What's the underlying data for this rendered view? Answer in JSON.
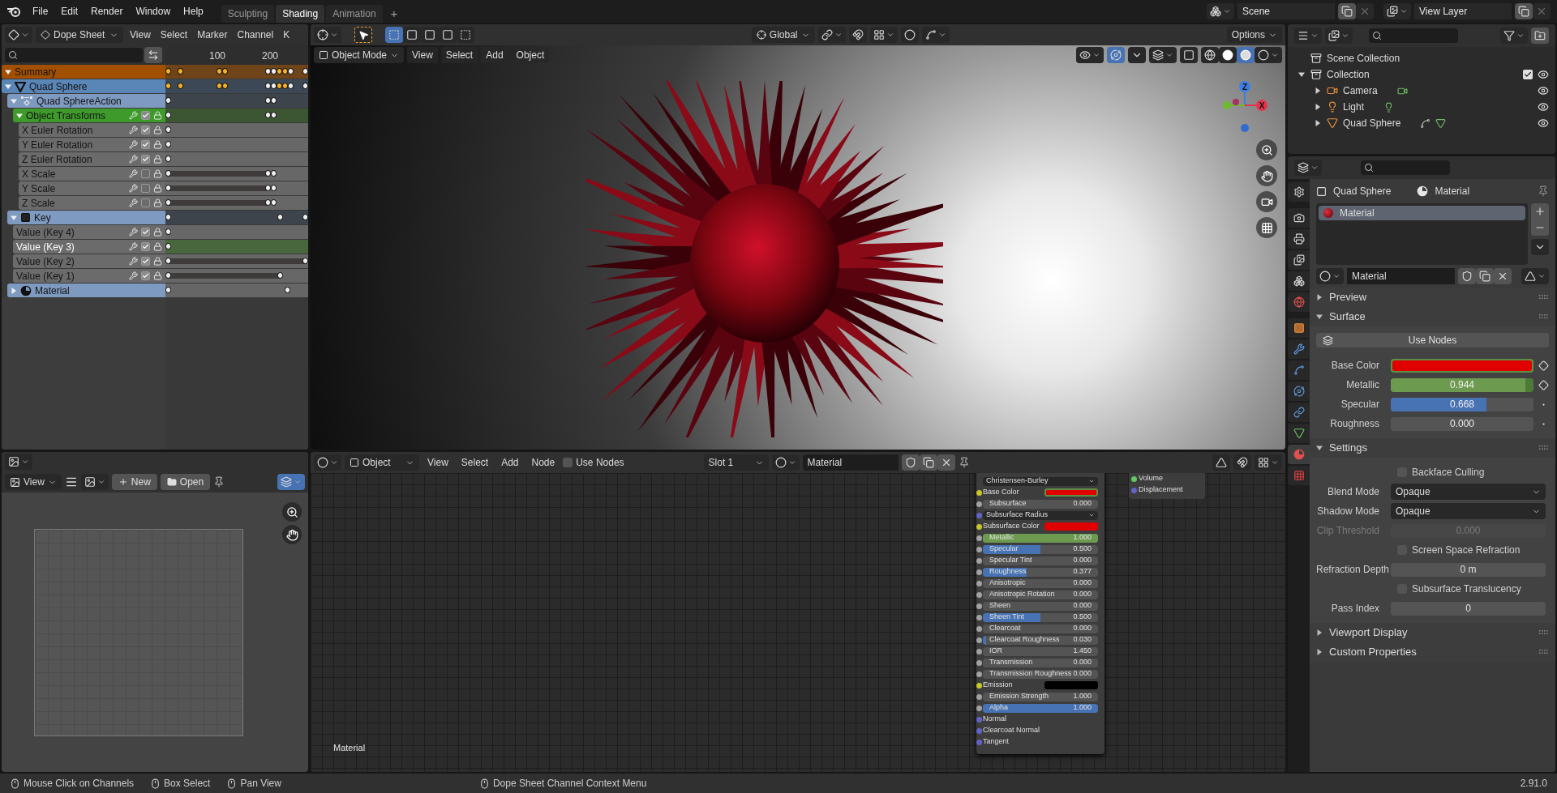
{
  "menu": [
    "File",
    "Edit",
    "Render",
    "Window",
    "Help"
  ],
  "workspaces": [
    {
      "label": "Sculpting",
      "selected": false
    },
    {
      "label": "Shading",
      "selected": true
    },
    {
      "label": "Animation",
      "selected": false
    }
  ],
  "add_workspace": "+",
  "scene": "Scene",
  "view_layer": "View Layer",
  "dope_sheet": {
    "mode": "Dope Sheet",
    "menus": [
      "View",
      "Select",
      "Marker",
      "Channel",
      "K"
    ],
    "ruler": [
      "100",
      "200"
    ],
    "channels": [
      {
        "name": "Summary",
        "kind": "summary",
        "expanded": true,
        "selected": false,
        "children": [
          {
            "name": "Quad Sphere",
            "kind": "object",
            "expanded": true,
            "selected": false,
            "children": [
              {
                "name": "Quad SphereAction",
                "kind": "action",
                "expanded": true,
                "selected": false,
                "children": [
                  {
                    "name": "Object Transforms",
                    "kind": "group",
                    "expanded": true,
                    "checked": true,
                    "selected": false,
                    "children": [
                      {
                        "name": "X Euler Rotation",
                        "kind": "fcurve",
                        "checked": true,
                        "selected": false
                      },
                      {
                        "name": "Y Euler Rotation",
                        "kind": "fcurve",
                        "checked": true,
                        "selected": false
                      },
                      {
                        "name": "Z Euler Rotation",
                        "kind": "fcurve",
                        "checked": true,
                        "selected": false
                      },
                      {
                        "name": "X Scale",
                        "kind": "fcurve",
                        "checked": false,
                        "selected": false
                      },
                      {
                        "name": "Y Scale",
                        "kind": "fcurve",
                        "checked": false,
                        "selected": false
                      },
                      {
                        "name": "Z Scale",
                        "kind": "fcurve",
                        "checked": false,
                        "selected": false
                      }
                    ]
                  }
                ]
              },
              {
                "name": "Key",
                "kind": "shapekey",
                "expanded": true,
                "selected": false,
                "children": [
                  {
                    "name": "Value (Key 4)",
                    "kind": "fcurve",
                    "checked": true,
                    "selected": false
                  },
                  {
                    "name": "Value (Key 3)",
                    "kind": "fcurve",
                    "checked": true,
                    "selected": true
                  },
                  {
                    "name": "Value (Key 2)",
                    "kind": "fcurve",
                    "checked": true,
                    "selected": false
                  },
                  {
                    "name": "Value (Key 1)",
                    "kind": "fcurve",
                    "checked": true,
                    "selected": false
                  }
                ]
              },
              {
                "name": "Material",
                "kind": "material",
                "expanded": false,
                "selected": false
              }
            ]
          }
        ]
      }
    ]
  },
  "image_editor": {
    "view": "View",
    "new": "New",
    "open": "Open"
  },
  "viewport": {
    "orientation": "Global",
    "options": "Options",
    "mode": "Object Mode",
    "menus": [
      "View",
      "Select",
      "Add",
      "Object"
    ],
    "gizmo_labels": [
      {
        "label": "Z",
        "color": "#3d7ee6"
      },
      {
        "label": "X",
        "color": "#e6334d"
      }
    ]
  },
  "node_editor": {
    "type": "Object",
    "menus": [
      "View",
      "Select",
      "Add",
      "Node"
    ],
    "use_nodes": {
      "label": "Use Nodes",
      "checked": false
    },
    "slot": "Slot 1",
    "material": "Material",
    "label": "Material",
    "bsdf": {
      "method": "Christensen-Burley",
      "inputs": [
        {
          "label": "Base Color",
          "kind": "color",
          "color": "#e00000",
          "animated": true
        },
        {
          "label": "Subsurface",
          "kind": "value",
          "value": "0.000",
          "level": 0,
          "animated": false
        },
        {
          "label": "Subsurface Radius",
          "kind": "menu"
        },
        {
          "label": "Subsurface Color",
          "kind": "color",
          "color": "#e00000",
          "animated": false
        },
        {
          "label": "Metallic",
          "kind": "value",
          "value": "1.000",
          "level": 1,
          "animated": true
        },
        {
          "label": "Specular",
          "kind": "value",
          "value": "0.500",
          "level": 0.5,
          "animated": false
        },
        {
          "label": "Specular Tint",
          "kind": "value",
          "value": "0.000",
          "level": 0,
          "animated": false
        },
        {
          "label": "Roughness",
          "kind": "value",
          "value": "0.377",
          "level": 0.377,
          "animated": false
        },
        {
          "label": "Anisotropic",
          "kind": "value",
          "value": "0.000",
          "level": 0,
          "animated": false
        },
        {
          "label": "Anisotropic Rotation",
          "kind": "value",
          "value": "0.000",
          "level": 0,
          "animated": false
        },
        {
          "label": "Sheen",
          "kind": "value",
          "value": "0.000",
          "level": 0,
          "animated": false
        },
        {
          "label": "Sheen Tint",
          "kind": "value",
          "value": "0.500",
          "level": 0.5,
          "animated": false
        },
        {
          "label": "Clearcoat",
          "kind": "value",
          "value": "0.000",
          "level": 0,
          "animated": false
        },
        {
          "label": "Clearcoat Roughness",
          "kind": "value",
          "value": "0.030",
          "level": 0.03,
          "animated": false
        },
        {
          "label": "IOR",
          "kind": "value",
          "value": "1.450",
          "level": 0,
          "animated": false
        },
        {
          "label": "Transmission",
          "kind": "value",
          "value": "0.000",
          "level": 0,
          "animated": false
        },
        {
          "label": "Transmission Roughness",
          "kind": "value",
          "value": "0.000",
          "level": 0,
          "animated": false
        },
        {
          "label": "Emission",
          "kind": "color",
          "color": "#000000",
          "animated": false
        },
        {
          "label": "Emission Strength",
          "kind": "value",
          "value": "1.000",
          "level": 0,
          "animated": false
        },
        {
          "label": "Alpha",
          "kind": "value",
          "value": "1.000",
          "level": 1,
          "animated": false
        },
        {
          "label": "Normal",
          "kind": "socket"
        },
        {
          "label": "Clearcoat Normal",
          "kind": "socket"
        },
        {
          "label": "Tangent",
          "kind": "socket"
        }
      ]
    },
    "output": [
      {
        "label": "Volume",
        "color": "#63c763"
      },
      {
        "label": "Displacement",
        "color": "#6363c7"
      }
    ]
  },
  "outliner": {
    "items": [
      {
        "name": "Scene Collection",
        "kind": "scene"
      },
      {
        "name": "Collection",
        "kind": "collection",
        "expanded": true,
        "checked": true,
        "children": [
          {
            "name": "Camera",
            "kind": "camera",
            "expanded": false
          },
          {
            "name": "Light",
            "kind": "light",
            "expanded": false
          },
          {
            "name": "Quad Sphere",
            "kind": "mesh",
            "expanded": false
          }
        ]
      }
    ]
  },
  "properties": {
    "tabs": [
      {
        "kind": "tool",
        "selected": false
      },
      {
        "kind": "render",
        "selected": false
      },
      {
        "kind": "output",
        "selected": false
      },
      {
        "kind": "view_layer",
        "selected": false
      },
      {
        "kind": "scene",
        "selected": false
      },
      {
        "kind": "world",
        "selected": false
      },
      {
        "kind": "object",
        "selected": false
      },
      {
        "kind": "modifiers",
        "selected": false
      },
      {
        "kind": "particles",
        "selected": false
      },
      {
        "kind": "physics",
        "selected": false
      },
      {
        "kind": "constraints",
        "selected": false
      },
      {
        "kind": "data",
        "selected": false
      },
      {
        "kind": "material",
        "selected": true
      },
      {
        "kind": "texture",
        "selected": false
      }
    ],
    "breadcrumb": [
      "Quad Sphere",
      "Material"
    ],
    "slots": [
      {
        "name": "Material",
        "selected": true
      }
    ],
    "material": "Material",
    "panels": [
      {
        "title": "Preview",
        "expanded": false
      },
      {
        "title": "Surface",
        "expanded": true,
        "button": "Use Nodes",
        "rows": [
          {
            "kind": "color",
            "label": "Base Color",
            "color": "#e00000",
            "animated": true
          },
          {
            "kind": "slider",
            "label": "Metallic",
            "value": "0.944",
            "level": 0.944,
            "animated": true
          },
          {
            "kind": "slider",
            "label": "Specular",
            "value": "0.668",
            "level": 0.668,
            "animated": false
          },
          {
            "kind": "slider",
            "label": "Roughness",
            "value": "0.000",
            "level": 0,
            "animated": false
          }
        ]
      },
      {
        "title": "Settings",
        "expanded": true,
        "rows": [
          {
            "kind": "checkbox",
            "label": "Backface Culling",
            "checked": false
          },
          {
            "kind": "dropdown",
            "label": "Blend Mode",
            "value": "Opaque"
          },
          {
            "kind": "dropdown",
            "label": "Shadow Mode",
            "value": "Opaque"
          },
          {
            "kind": "number",
            "label": "Clip Threshold",
            "value": "0.000",
            "disabled": true
          },
          {
            "kind": "checkbox",
            "label": "Screen Space Refraction",
            "checked": false
          },
          {
            "kind": "number",
            "label": "Refraction Depth",
            "value": "0 m",
            "disabled": false
          },
          {
            "kind": "checkbox",
            "label": "Subsurface Translucency",
            "checked": false
          },
          {
            "kind": "number",
            "label": "Pass Index",
            "value": "0",
            "disabled": false
          }
        ]
      },
      {
        "title": "Viewport Display",
        "expanded": false
      },
      {
        "title": "Custom Properties",
        "expanded": false
      }
    ]
  },
  "status_bar": {
    "items": [
      "Mouse Click on Channels",
      "Box Select",
      "Pan View",
      "Dope Sheet Channel Context Menu"
    ],
    "version": "2.91.0"
  }
}
